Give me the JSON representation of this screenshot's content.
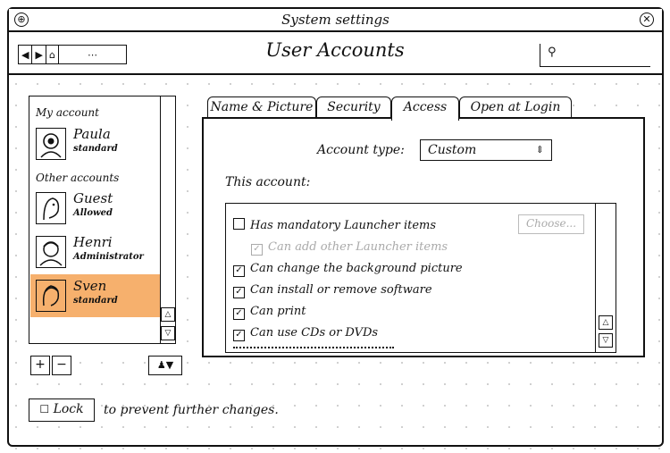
{
  "window": {
    "title": "System settings"
  },
  "toolbar": {
    "page_title": "User Accounts"
  },
  "sidebar": {
    "my_account_label": "My account",
    "other_accounts_label": "Other accounts",
    "users": [
      {
        "name": "Paula",
        "role": "standard"
      },
      {
        "name": "Guest",
        "role": "Allowed"
      },
      {
        "name": "Henri",
        "role": "Administrator"
      },
      {
        "name": "Sven",
        "role": "standard"
      }
    ],
    "add_label": "+",
    "remove_label": "−"
  },
  "tabs": [
    {
      "label": "Name & Picture"
    },
    {
      "label": "Security"
    },
    {
      "label": "Access"
    },
    {
      "label": "Open at Login"
    }
  ],
  "access": {
    "account_type_label": "Account type:",
    "account_type_value": "Custom",
    "this_account_label": "This account:",
    "choose_label": "Choose...",
    "permissions": [
      {
        "label": "Has mandatory Launcher items",
        "checked": false,
        "enabled": true
      },
      {
        "label": "Can add other Launcher items",
        "checked": true,
        "enabled": false
      },
      {
        "label": "Can change the background picture",
        "checked": true,
        "enabled": true
      },
      {
        "label": "Can install or remove software",
        "checked": true,
        "enabled": true
      },
      {
        "label": "Can print",
        "checked": true,
        "enabled": true
      },
      {
        "label": "Can use CDs or DVDs",
        "checked": true,
        "enabled": true
      }
    ]
  },
  "footer": {
    "lock_label": "Lock",
    "lock_text": "to prevent further changes."
  },
  "colors": {
    "selection": "#f6b06d",
    "ink": "#111111",
    "disabled": "#aaaaaa"
  }
}
